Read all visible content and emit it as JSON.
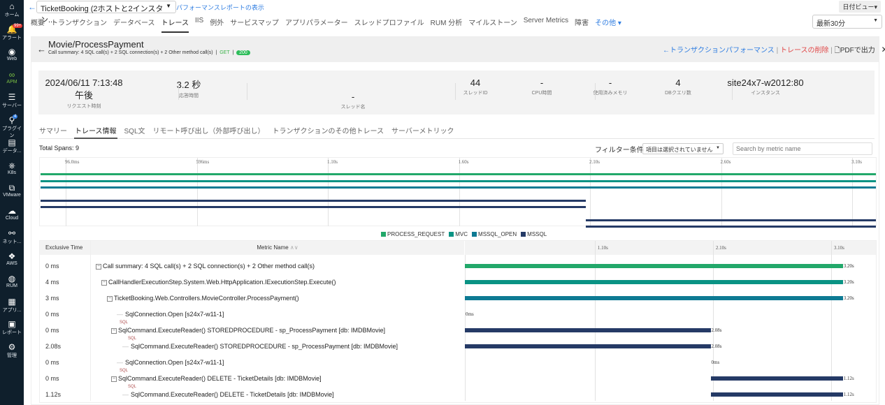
{
  "sidebar": {
    "items": [
      {
        "label": "ホーム",
        "icon": "home-icon",
        "glyph": "⌂"
      },
      {
        "label": "アラート",
        "icon": "bell-icon",
        "glyph": "🔔",
        "badge": "99+"
      },
      {
        "label": "Web",
        "icon": "globe-icon",
        "glyph": "◉"
      },
      {
        "label": "APM",
        "icon": "apm-icon",
        "glyph": "∞",
        "active": true
      },
      {
        "label": "サーバー",
        "icon": "server-icon",
        "glyph": "☰"
      },
      {
        "label": "プラグイン",
        "icon": "plugin-icon",
        "glyph": "⚲",
        "badge": "4"
      },
      {
        "label": "データ...",
        "icon": "database-icon",
        "glyph": "▤"
      },
      {
        "label": "K8s",
        "icon": "kubernetes-icon",
        "glyph": "⎈"
      },
      {
        "label": "VMware",
        "icon": "vmware-icon",
        "glyph": "⧉"
      },
      {
        "label": "Cloud",
        "icon": "cloud-icon",
        "glyph": "☁"
      },
      {
        "label": "ネット...",
        "icon": "network-icon",
        "glyph": "⚯"
      },
      {
        "label": "AWS",
        "icon": "aws-icon",
        "glyph": "❖"
      },
      {
        "label": "RUM",
        "icon": "rum-icon",
        "glyph": "◍"
      },
      {
        "label": "アプリ...",
        "icon": "app-icon",
        "glyph": "▦"
      },
      {
        "label": "レポート",
        "icon": "report-icon",
        "glyph": "▣"
      },
      {
        "label": "管理",
        "icon": "gear-icon",
        "glyph": "⚙"
      }
    ]
  },
  "topbar": {
    "app_select": "TicketBooking (2ホストと2インスタン...",
    "report_link": "パフォーマンスレポートの表示",
    "date_view": "日付ビュー▾",
    "time_range": "最新30分",
    "nav": [
      "概要",
      "トランザクション",
      "データベース",
      "トレース",
      "IIS",
      "例外",
      "サービスマップ",
      "アプリパラメーター",
      "スレッドプロファイル",
      "RUM 分析",
      "マイルストーン",
      "Server Metrics",
      "障害",
      "その他 ▾"
    ],
    "nav_active": 3
  },
  "trace": {
    "title": "Movie/ProcessPayment",
    "summary": "Call summary: 4 SQL call(s) + 2 SQL connection(s) + 2 Other method call(s)",
    "method": "GET",
    "status": "200",
    "tx_link": "トランザクションパフォーマンス",
    "delete_link": "トレースの削除",
    "pdf": "PDFで出力"
  },
  "stats": [
    {
      "value": "2024/06/11 7:13:48 午後",
      "label": "リクエスト時刻"
    },
    {
      "value": "3.2 秒",
      "label": "応答時間"
    },
    {
      "value": "-",
      "label": "スレッド名"
    },
    {
      "value": "44",
      "label": "スレッドID"
    },
    {
      "value": "-",
      "label": "CPU時間"
    },
    {
      "value": "-",
      "label": "使用済みメモリ"
    },
    {
      "value": "4",
      "label": "DBクエリ数"
    },
    {
      "value": "site24x7-w2012:80",
      "label": "インスタンス"
    }
  ],
  "tabs": [
    "サマリー",
    "トレース情報",
    "SQL文",
    "リモート呼び出し（外部呼び出し）",
    "トランザクションのその他トレース",
    "サーバーメトリック"
  ],
  "tab_active": 1,
  "total_spans": "Total Spans: 9",
  "filter": {
    "label": "フィルター条件",
    "select": "項目は選択されていません",
    "search_placeholder": "Search by metric name"
  },
  "colors": {
    "PROCESS_REQUEST": "#22a86a",
    "MVC": "#0a9384",
    "MSSQL_OPEN": "#0d7a93",
    "MSSQL": "#253a66"
  },
  "chart_data": {
    "type": "gantt",
    "overview_ticks": [
      "96.0ms",
      "596ms",
      "1.10s",
      "1.60s",
      "2.10s",
      "2.60s",
      "3.10s"
    ],
    "table_ticks": [
      "1.10s",
      "2.10s",
      "3.10s"
    ],
    "legend": [
      "PROCESS_REQUEST",
      "MVC",
      "MSSQL_OPEN",
      "MSSQL"
    ],
    "columns": {
      "exclusive": "Exclusive Time",
      "metric": "Metric Name"
    },
    "spans": [
      {
        "excl": "0 ms",
        "name": "Call summary: 4 SQL call(s) + 2 SQL connection(s) + 2 Other method call(s)",
        "depth": 0,
        "toggle": true,
        "start": 0,
        "dur": 3.2,
        "label": "3.20s",
        "type": "PROCESS_REQUEST"
      },
      {
        "excl": "4 ms",
        "name": "CallHandlerExecutionStep.System.Web.HttpApplication.IExecutionStep.Execute()",
        "depth": 1,
        "toggle": true,
        "start": 0,
        "dur": 3.2,
        "label": "3.20s",
        "type": "MVC"
      },
      {
        "excl": "3 ms",
        "name": "TicketBooking.Web.Controllers.MovieController.ProcessPayment()",
        "depth": 2,
        "toggle": true,
        "start": 0,
        "dur": 3.2,
        "label": "3.20s",
        "type": "MSSQL_OPEN"
      },
      {
        "excl": "0 ms",
        "name": "SqlConnection.Open [s24x7-w11-1]",
        "depth": 3,
        "start": 0,
        "dur": 0,
        "label": "0ms",
        "type": "MSSQL"
      },
      {
        "excl": "0 ms",
        "name": "SqlCommand.ExecuteReader() STOREDPROCEDURE - sp_ProcessPayment [db: IMDBMovie]",
        "depth": 3,
        "toggle": true,
        "sql": "SQL",
        "start": 0,
        "dur": 2.08,
        "label": "2.08s",
        "type": "MSSQL"
      },
      {
        "excl": "2.08s",
        "name": "SqlCommand.ExecuteReader() STOREDPROCEDURE - sp_ProcessPayment [db: IMDBMovie]",
        "depth": 4,
        "sql": "SQL",
        "start": 0,
        "dur": 2.08,
        "label": "2.08s",
        "type": "MSSQL"
      },
      {
        "excl": "0 ms",
        "name": "SqlConnection.Open [s24x7-w11-1]",
        "depth": 3,
        "start": 2.08,
        "dur": 0,
        "label": "0ms",
        "type": "MSSQL"
      },
      {
        "excl": "0 ms",
        "name": "SqlCommand.ExecuteReader() DELETE - TicketDetails [db: IMDBMovie]",
        "depth": 3,
        "toggle": true,
        "sql": "SQL",
        "start": 2.08,
        "dur": 1.12,
        "label": "1.12s",
        "type": "MSSQL"
      },
      {
        "excl": "1.12s",
        "name": "SqlCommand.ExecuteReader() DELETE - TicketDetails [db: IMDBMovie]",
        "depth": 4,
        "sql": "SQL",
        "start": 2.08,
        "dur": 1.12,
        "label": "1.12s",
        "type": "MSSQL"
      }
    ]
  }
}
